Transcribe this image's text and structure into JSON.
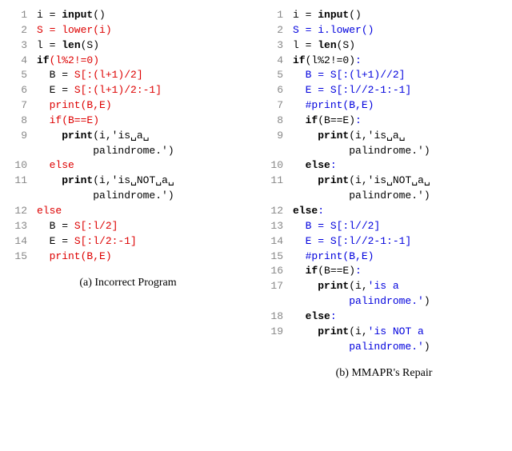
{
  "left": {
    "caption": "(a) Incorrect Program",
    "lines": [
      {
        "n": "1",
        "segs": [
          {
            "t": "i = ",
            "c": "black"
          },
          {
            "t": "input",
            "c": "kw"
          },
          {
            "t": "()",
            "c": "black"
          }
        ]
      },
      {
        "n": "2",
        "segs": [
          {
            "t": "S = lower(i)",
            "c": "red"
          }
        ]
      },
      {
        "n": "3",
        "segs": [
          {
            "t": "l = ",
            "c": "black"
          },
          {
            "t": "len",
            "c": "kw"
          },
          {
            "t": "(S)",
            "c": "black"
          }
        ]
      },
      {
        "n": "4",
        "segs": [
          {
            "t": "if",
            "c": "kw"
          },
          {
            "t": "(l%2!=0)",
            "c": "red"
          }
        ]
      },
      {
        "n": "5",
        "segs": [
          {
            "t": "  B = ",
            "c": "black"
          },
          {
            "t": "S[:(l+1)/2]",
            "c": "red"
          }
        ]
      },
      {
        "n": "6",
        "segs": [
          {
            "t": "  E = ",
            "c": "black"
          },
          {
            "t": "S[:(l+1)/2:-1]",
            "c": "red"
          }
        ]
      },
      {
        "n": "7",
        "segs": [
          {
            "t": "  print(B,E)",
            "c": "red"
          }
        ]
      },
      {
        "n": "8",
        "segs": [
          {
            "t": "  if(B==E)",
            "c": "red"
          }
        ]
      },
      {
        "n": "9",
        "segs": [
          {
            "t": "    ",
            "c": "black"
          },
          {
            "t": "print",
            "c": "kw"
          },
          {
            "t": "(i,'is␣a␣\n         palindrome.')",
            "c": "black"
          }
        ]
      },
      {
        "n": "10",
        "segs": [
          {
            "t": "  else",
            "c": "red"
          }
        ]
      },
      {
        "n": "11",
        "segs": [
          {
            "t": "    ",
            "c": "black"
          },
          {
            "t": "print",
            "c": "kw"
          },
          {
            "t": "(i,'is␣NOT␣a␣\n         palindrome.')",
            "c": "black"
          }
        ]
      },
      {
        "n": "12",
        "segs": [
          {
            "t": "else",
            "c": "red"
          }
        ]
      },
      {
        "n": "13",
        "segs": [
          {
            "t": "  B = ",
            "c": "black"
          },
          {
            "t": "S[:l/2]",
            "c": "red"
          }
        ]
      },
      {
        "n": "14",
        "segs": [
          {
            "t": "  E = ",
            "c": "black"
          },
          {
            "t": "S[:l/2:-1]",
            "c": "red"
          }
        ]
      },
      {
        "n": "15",
        "segs": [
          {
            "t": "  print(B,E)",
            "c": "red"
          }
        ]
      }
    ]
  },
  "right": {
    "caption": "(b) MMAPR's Repair",
    "lines": [
      {
        "n": "1",
        "segs": [
          {
            "t": "i = ",
            "c": "black"
          },
          {
            "t": "input",
            "c": "kw"
          },
          {
            "t": "()",
            "c": "black"
          }
        ]
      },
      {
        "n": "2",
        "segs": [
          {
            "t": "S = i.lower()",
            "c": "blue"
          }
        ]
      },
      {
        "n": "3",
        "segs": [
          {
            "t": "l = ",
            "c": "black"
          },
          {
            "t": "len",
            "c": "kw"
          },
          {
            "t": "(S)",
            "c": "black"
          }
        ]
      },
      {
        "n": "4",
        "segs": [
          {
            "t": "if",
            "c": "kw"
          },
          {
            "t": "(l%2!=0)",
            "c": "black"
          },
          {
            "t": ":",
            "c": "blue"
          }
        ]
      },
      {
        "n": "5",
        "segs": [
          {
            "t": "  ",
            "c": "black"
          },
          {
            "t": "B = S[:(l+1)//2]",
            "c": "blue"
          }
        ]
      },
      {
        "n": "6",
        "segs": [
          {
            "t": "  ",
            "c": "black"
          },
          {
            "t": "E = S[:l//2-1:-1]",
            "c": "blue"
          }
        ]
      },
      {
        "n": "7",
        "segs": [
          {
            "t": "  ",
            "c": "black"
          },
          {
            "t": "#print(B,E)",
            "c": "blue"
          }
        ]
      },
      {
        "n": "8",
        "segs": [
          {
            "t": "  ",
            "c": "black"
          },
          {
            "t": "if",
            "c": "kw"
          },
          {
            "t": "(B==E)",
            "c": "black"
          },
          {
            "t": ":",
            "c": "blue"
          }
        ]
      },
      {
        "n": "9",
        "segs": [
          {
            "t": "    ",
            "c": "black"
          },
          {
            "t": "print",
            "c": "kw"
          },
          {
            "t": "(i,'is␣a␣\n         palindrome.')",
            "c": "black"
          }
        ]
      },
      {
        "n": "10",
        "segs": [
          {
            "t": "  ",
            "c": "black"
          },
          {
            "t": "else",
            "c": "kw"
          },
          {
            "t": ":",
            "c": "blue"
          }
        ]
      },
      {
        "n": "11",
        "segs": [
          {
            "t": "    ",
            "c": "black"
          },
          {
            "t": "print",
            "c": "kw"
          },
          {
            "t": "(i,'is␣NOT␣a␣\n         palindrome.')",
            "c": "black"
          }
        ]
      },
      {
        "n": "12",
        "segs": [
          {
            "t": "else",
            "c": "kw"
          },
          {
            "t": ":",
            "c": "blue"
          }
        ]
      },
      {
        "n": "13",
        "segs": [
          {
            "t": "  ",
            "c": "black"
          },
          {
            "t": "B = S[:l//2]",
            "c": "blue"
          }
        ]
      },
      {
        "n": "14",
        "segs": [
          {
            "t": "  ",
            "c": "black"
          },
          {
            "t": "E = S[:l//2-1:-1]",
            "c": "blue"
          }
        ]
      },
      {
        "n": "15",
        "segs": [
          {
            "t": "  ",
            "c": "black"
          },
          {
            "t": "#print(B,E)",
            "c": "blue"
          }
        ]
      },
      {
        "n": "16",
        "segs": [
          {
            "t": "  ",
            "c": "black"
          },
          {
            "t": "if",
            "c": "kw"
          },
          {
            "t": "(B==E)",
            "c": "black"
          },
          {
            "t": ":",
            "c": "blue"
          }
        ]
      },
      {
        "n": "17",
        "segs": [
          {
            "t": "    ",
            "c": "black"
          },
          {
            "t": "print",
            "c": "kw"
          },
          {
            "t": "(i,",
            "c": "black"
          },
          {
            "t": "'is a\n         palindrome.'",
            "c": "blue"
          },
          {
            "t": ")",
            "c": "black"
          }
        ]
      },
      {
        "n": "18",
        "segs": [
          {
            "t": "  ",
            "c": "black"
          },
          {
            "t": "else",
            "c": "kw"
          },
          {
            "t": ":",
            "c": "blue"
          }
        ]
      },
      {
        "n": "19",
        "segs": [
          {
            "t": "    ",
            "c": "black"
          },
          {
            "t": "print",
            "c": "kw"
          },
          {
            "t": "(i,",
            "c": "black"
          },
          {
            "t": "'is NOT a\n         palindrome.'",
            "c": "blue"
          },
          {
            "t": ")",
            "c": "black"
          }
        ]
      }
    ]
  }
}
